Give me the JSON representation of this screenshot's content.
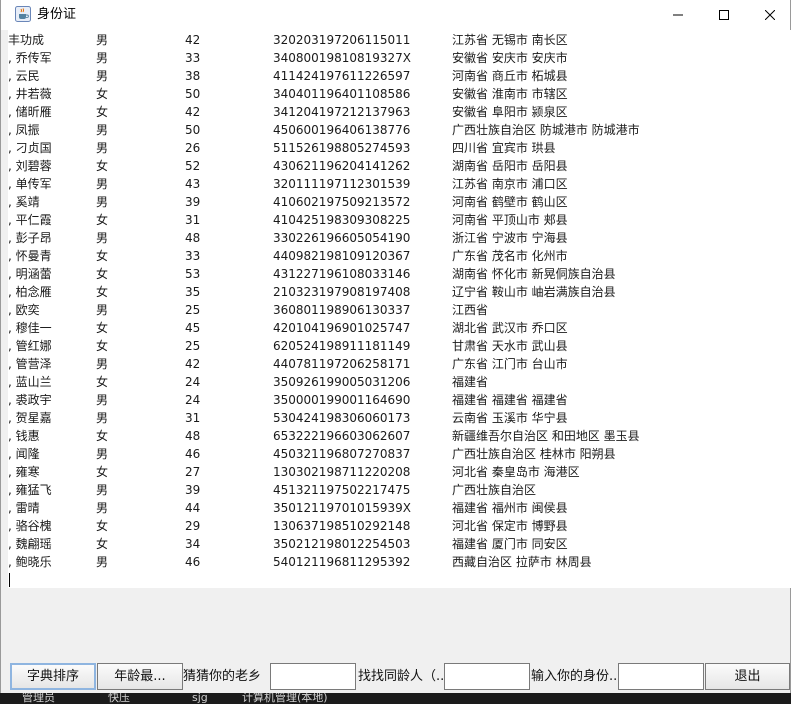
{
  "window": {
    "title": "身份证",
    "icon": "java-cup-icon",
    "controls": [
      "minimize-icon",
      "maximize-icon",
      "close-icon"
    ]
  },
  "records": [
    {
      "name": "丰功成",
      "sex": "男",
      "age": "42",
      "id": "320203197206115011",
      "address": "江苏省 无锡市 南长区"
    },
    {
      "name": ", 乔传军",
      "sex": "男",
      "age": "33",
      "id": "34080019810819327X",
      "address": "安徽省 安庆市 安庆市"
    },
    {
      "name": ", 云民",
      "sex": "男",
      "age": "38",
      "id": "411424197611226597",
      "address": "河南省 商丘市 柘城县"
    },
    {
      "name": ", 井若薇",
      "sex": "女",
      "age": "50",
      "id": "340401196401108586",
      "address": "安徽省 淮南市 市辖区"
    },
    {
      "name": ", 储昕雁",
      "sex": "女",
      "age": "42",
      "id": "341204197212137963",
      "address": "安徽省 阜阳市 颍泉区"
    },
    {
      "name": ", 凤振",
      "sex": "男",
      "age": "50",
      "id": "450600196406138776",
      "address": "广西壮族自治区 防城港市 防城港市"
    },
    {
      "name": ", 刁贞国",
      "sex": "男",
      "age": "26",
      "id": "511526198805274593",
      "address": "四川省 宜宾市 珙县"
    },
    {
      "name": ", 刘碧蓉",
      "sex": "女",
      "age": "52",
      "id": "430621196204141262",
      "address": "湖南省 岳阳市 岳阳县"
    },
    {
      "name": ", 单传军",
      "sex": "男",
      "age": "43",
      "id": "320111197112301539",
      "address": "江苏省 南京市 浦口区"
    },
    {
      "name": ", 奚靖",
      "sex": "男",
      "age": "39",
      "id": "410602197509213572",
      "address": "河南省 鹤壁市 鹤山区"
    },
    {
      "name": ", 平仁霞",
      "sex": "女",
      "age": "31",
      "id": "410425198309308225",
      "address": "河南省 平顶山市 郏县"
    },
    {
      "name": ", 彭子昂",
      "sex": "男",
      "age": "48",
      "id": "330226196605054190",
      "address": "浙江省 宁波市 宁海县"
    },
    {
      "name": ", 怀曼青",
      "sex": "女",
      "age": "33",
      "id": "440982198109120367",
      "address": "广东省 茂名市 化州市"
    },
    {
      "name": ", 明涵蕾",
      "sex": "女",
      "age": "53",
      "id": "431227196108033146",
      "address": "湖南省 怀化市 新晃侗族自治县"
    },
    {
      "name": ", 柏念雁",
      "sex": "女",
      "age": "35",
      "id": "210323197908197408",
      "address": "辽宁省 鞍山市 岫岩满族自治县"
    },
    {
      "name": ", 欧奕",
      "sex": "男",
      "age": "25",
      "id": "360801198906130337",
      "address": "江西省"
    },
    {
      "name": ", 穆佳一",
      "sex": "女",
      "age": "45",
      "id": "420104196901025747",
      "address": "湖北省 武汉市 乔口区"
    },
    {
      "name": ", 管红娜",
      "sex": "女",
      "age": "25",
      "id": "620524198911181149",
      "address": "甘肃省 天水市 武山县"
    },
    {
      "name": ", 管营泽",
      "sex": "男",
      "age": "42",
      "id": "440781197206258171",
      "address": "广东省 江门市 台山市"
    },
    {
      "name": ", 蓝山兰",
      "sex": "女",
      "age": "24",
      "id": "350926199005031206",
      "address": "福建省"
    },
    {
      "name": ", 裘政宇",
      "sex": "男",
      "age": "24",
      "id": "350000199001164690",
      "address": "福建省 福建省 福建省"
    },
    {
      "name": ", 贺星嘉",
      "sex": "男",
      "age": "31",
      "id": "530424198306060173",
      "address": "云南省 玉溪市 华宁县"
    },
    {
      "name": ", 钱惠",
      "sex": "女",
      "age": "48",
      "id": "653222196603062607",
      "address": "新疆维吾尔自治区 和田地区 墨玉县"
    },
    {
      "name": ", 闻隆",
      "sex": "男",
      "age": "46",
      "id": "450321196807270837",
      "address": "广西壮族自治区 桂林市 阳朔县"
    },
    {
      "name": ", 雍寒",
      "sex": "女",
      "age": "27",
      "id": "130302198711220208",
      "address": "河北省 秦皇岛市 海港区"
    },
    {
      "name": ", 雍猛飞",
      "sex": "男",
      "age": "39",
      "id": "451321197502217475",
      "address": "广西壮族自治区"
    },
    {
      "name": ", 雷晴",
      "sex": "男",
      "age": "44",
      "id": "35012119701015939X",
      "address": "福建省 福州市 闽侯县"
    },
    {
      "name": ", 骆谷槐",
      "sex": "女",
      "age": "29",
      "id": "130637198510292148",
      "address": "河北省 保定市 博野县"
    },
    {
      "name": ", 魏翩瑶",
      "sex": "女",
      "age": "34",
      "id": "350212198012254503",
      "address": "福建省 厦门市 同安区"
    },
    {
      "name": ", 鲍晓乐",
      "sex": "男",
      "age": "46",
      "id": "540121196811295392",
      "address": "西藏自治区 拉萨市 林周县"
    }
  ],
  "toolbar": {
    "sort_button": "字典排序",
    "age_button": "年龄最...",
    "hometown_label": "猜猜你的老乡",
    "hometown_value": "",
    "peer_label": "找找同龄人（...",
    "peer_value": "",
    "idcard_label": "输入你的身份...",
    "idcard_value": "",
    "exit_button": "退出"
  },
  "desktop": {
    "items": [
      "管理员",
      "快压",
      "sjg",
      "计算机管理(本地)"
    ]
  }
}
